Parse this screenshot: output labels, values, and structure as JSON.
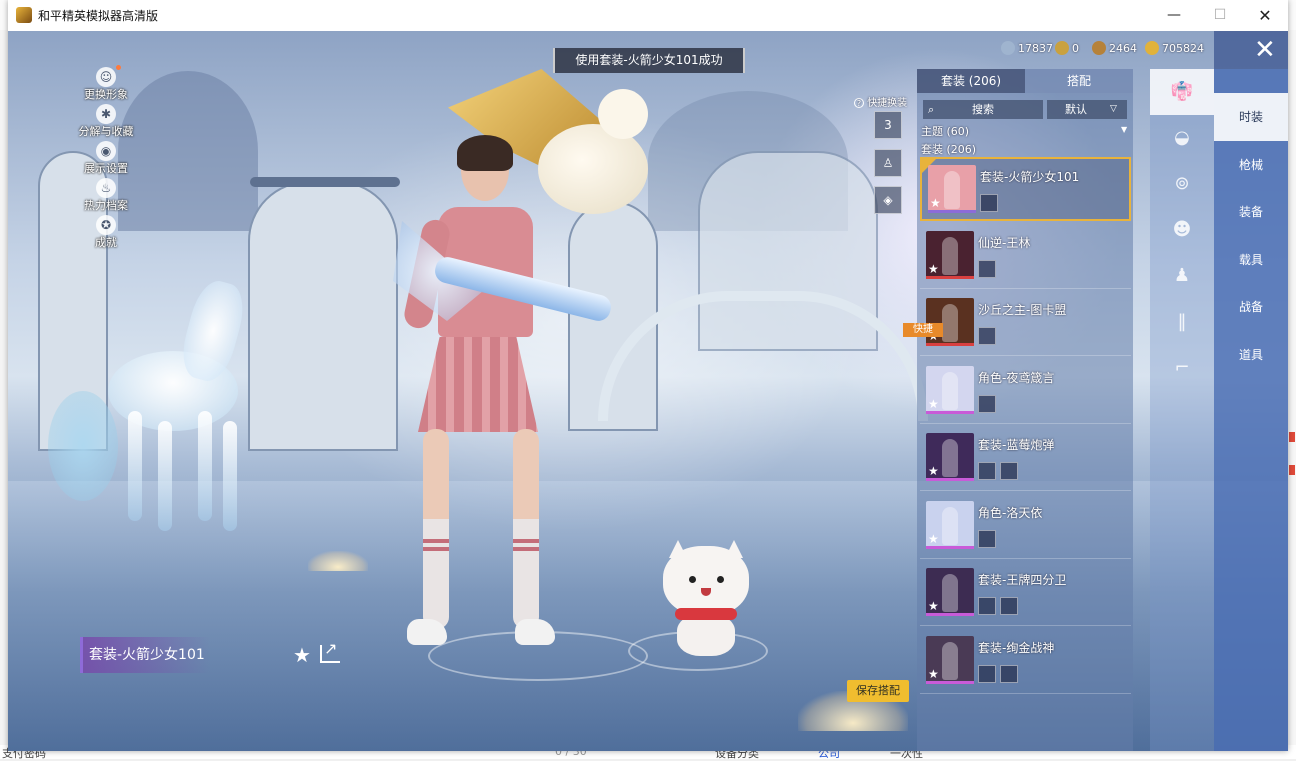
{
  "window": {
    "title": "和平精英模拟器高清版",
    "minimize": "—",
    "maximize": "☐",
    "close": "✕"
  },
  "toast": "使用套装-火箭少女101成功",
  "left_menu": [
    {
      "label": "更换形象",
      "icon": "person-icon",
      "glyph": "☺"
    },
    {
      "label": "分解与收藏",
      "icon": "settings-icon",
      "glyph": "✱"
    },
    {
      "label": "展示设置",
      "icon": "eye-icon",
      "glyph": "◉"
    },
    {
      "label": "热力档案",
      "icon": "flame-icon",
      "glyph": "♨"
    },
    {
      "label": "成就",
      "icon": "trophy-icon",
      "glyph": "✪"
    }
  ],
  "currencies": [
    {
      "value": "17837",
      "icon": "gem-icon",
      "color": "#9fb4cf"
    },
    {
      "value": "0",
      "icon": "coin-icon",
      "color": "#c9a13f"
    },
    {
      "value": "2464",
      "icon": "bronze-coin-icon",
      "color": "#b6823a"
    },
    {
      "value": "705824",
      "icon": "gold-coin-icon",
      "color": "#e1b23b"
    }
  ],
  "close_label": "✕",
  "quick_swap": {
    "title": "快捷换装",
    "help": "?",
    "hanger_count": "3"
  },
  "panel": {
    "tab_outfits": "套装 (206)",
    "tab_match": "搭配",
    "search_placeholder": "搜索",
    "sort": "默认",
    "theme": "主题 (60)",
    "outfit_count": "套装 (206)",
    "quick_tag": "快捷"
  },
  "outfits": [
    {
      "name": "套装-火箭少女101",
      "thumb": "#e8a0a8",
      "rarity": "#8c6bd8",
      "minis": 1,
      "selected": true
    },
    {
      "name": "仙逆-王林",
      "thumb": "#4a2230",
      "rarity": "#d94040",
      "minis": 1,
      "selected": false
    },
    {
      "name": "沙丘之主-图卡盟",
      "thumb": "#5a3120",
      "rarity": "#d94040",
      "minis": 1,
      "selected": false
    },
    {
      "name": "角色-夜鸢箴言",
      "thumb": "#d3d6ef",
      "rarity": "#c85bd8",
      "minis": 1,
      "selected": false
    },
    {
      "name": "套装-蓝莓炮弹",
      "thumb": "#3f2a5a",
      "rarity": "#c85bd8",
      "minis": 2,
      "selected": false
    },
    {
      "name": "角色-洛天依",
      "thumb": "#c9d2ee",
      "rarity": "#c85bd8",
      "minis": 1,
      "selected": false
    },
    {
      "name": "套装-王牌四分卫",
      "thumb": "#3d2c52",
      "rarity": "#c85bd8",
      "minis": 2,
      "selected": false
    },
    {
      "name": "套装-绚金战神",
      "thumb": "#4a3a55",
      "rarity": "#c85bd8",
      "minis": 2,
      "selected": false
    }
  ],
  "categories": [
    {
      "label": "时装",
      "icon": "outfit-icon",
      "glyph": "👘",
      "active": true
    },
    {
      "label": "枪械",
      "icon": "cap-icon",
      "glyph": "◒",
      "active": false
    },
    {
      "label": "装备",
      "icon": "goggles-icon",
      "glyph": "⊚",
      "active": false
    },
    {
      "label": "载具",
      "icon": "mask-icon",
      "glyph": "☻",
      "active": false
    },
    {
      "label": "战备",
      "icon": "dress-icon",
      "glyph": "♟",
      "active": false
    },
    {
      "label": "道具",
      "icon": "pants-icon",
      "glyph": "‖",
      "active": false
    },
    {
      "label": "",
      "icon": "shoes-icon",
      "glyph": "⌐",
      "active": false
    }
  ],
  "current_outfit": "套装-火箭少女101",
  "save_button": "保存搭配",
  "behind_text": {
    "a": "支付密码",
    "b": "0 / 30",
    "c": "设备分类",
    "d": "公司",
    "e": "一次性"
  }
}
